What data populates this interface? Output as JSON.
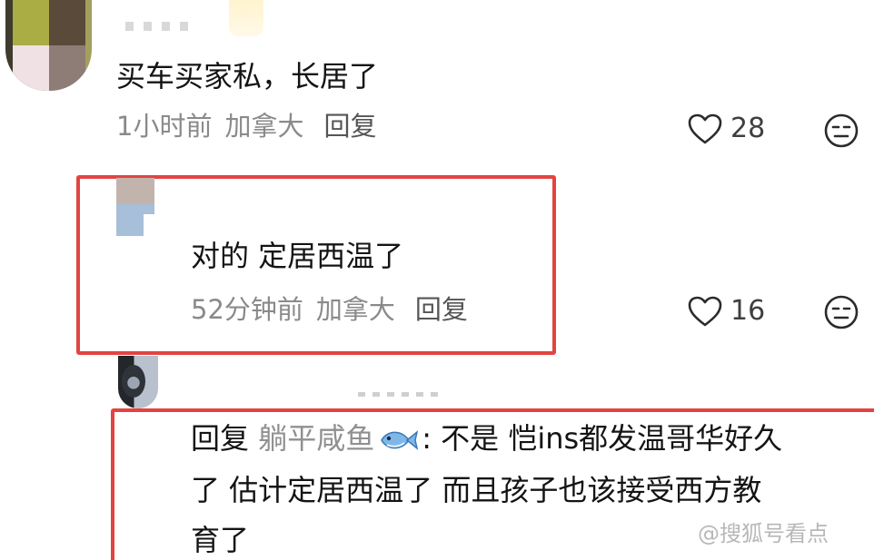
{
  "comment": {
    "text": "买车买家私，长居了",
    "time": "1小时前",
    "location": "加拿大",
    "reply_label": "回复",
    "likes": "28"
  },
  "reply1": {
    "text": "对的 定居西温了",
    "time": "52分钟前",
    "location": "加拿大",
    "reply_label": "回复",
    "likes": "16"
  },
  "reply2": {
    "prefix": "回复",
    "target_user": "躺平咸鱼",
    "line1_rest": ": 不是 恺ins都发温哥华好久",
    "line2": "了 估计定居西温了 而且孩子也该接受西方教",
    "line3": "育了"
  },
  "watermark": "@搜狐号看点"
}
